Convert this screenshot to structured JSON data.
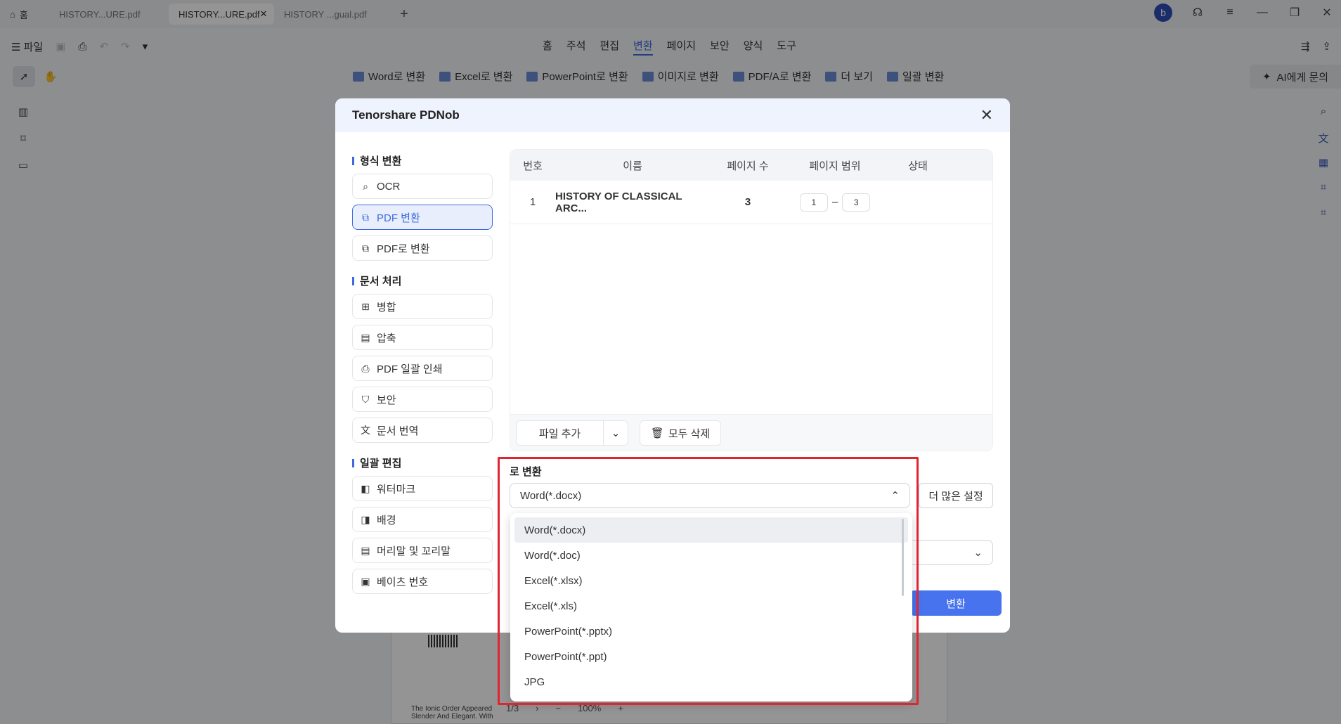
{
  "titlebar": {
    "home_label": "홈",
    "tabs": [
      "HISTORY...URE.pdf",
      "HISTORY...URE.pdf",
      "HISTORY ...gual.pdf"
    ],
    "avatar_letter": "b"
  },
  "menubar": {
    "file_label": "파일",
    "items": [
      "홈",
      "주석",
      "편집",
      "변환",
      "페이지",
      "보안",
      "양식",
      "도구"
    ],
    "active_item": "변환"
  },
  "toolbar": {
    "items": [
      "Word로 변환",
      "Excel로 변환",
      "PowerPoint로 변환",
      "이미지로 변환",
      "PDF/A로 변환",
      "더 보기",
      "일괄 변환"
    ],
    "ai_label": "AI에게 문의"
  },
  "dialog": {
    "title": "Tenorshare PDNob",
    "sections": [
      {
        "title": "형식 변환",
        "items": [
          "OCR",
          "PDF 변환",
          "PDF로 변환"
        ]
      },
      {
        "title": "문서 처리",
        "items": [
          "병합",
          "압축",
          "PDF 일괄 인쇄",
          "보안",
          "문서 번역"
        ]
      },
      {
        "title": "일괄 편집",
        "items": [
          "워터마크",
          "배경",
          "머리말 및 꼬리말",
          "베이츠 번호"
        ]
      }
    ],
    "selected_item": "PDF 변환",
    "table": {
      "headers": [
        "번호",
        "이름",
        "페이지 수",
        "페이지 범위",
        "상태"
      ],
      "rows": [
        {
          "num": "1",
          "name": "HISTORY OF CLASSICAL ARC...",
          "pages": "3",
          "range_from": "1",
          "range_sep": "–",
          "range_to": "3",
          "status": ""
        }
      ]
    },
    "add_file_label": "파일 추가",
    "delete_all_label": "모두 삭제",
    "convert_to_label": "로 변환",
    "selected_format": "Word(*.docx)",
    "more_settings_label": "더 많은 설정",
    "convert_button": "변환",
    "format_options": [
      "Word(*.docx)",
      "Word(*.doc)",
      "Excel(*.xlsx)",
      "Excel(*.xls)",
      "PowerPoint(*.pptx)",
      "PowerPoint(*.ppt)",
      "JPG"
    ]
  },
  "document": {
    "text_line1": "The Ionic Order Appeared",
    "text_line2": "Slender And Elegant. With",
    "page_indicator": "1/3",
    "zoom": "100%"
  },
  "colors": {
    "accent": "#3d6ae0",
    "highlight": "#e02432",
    "button": "#4773ee"
  }
}
